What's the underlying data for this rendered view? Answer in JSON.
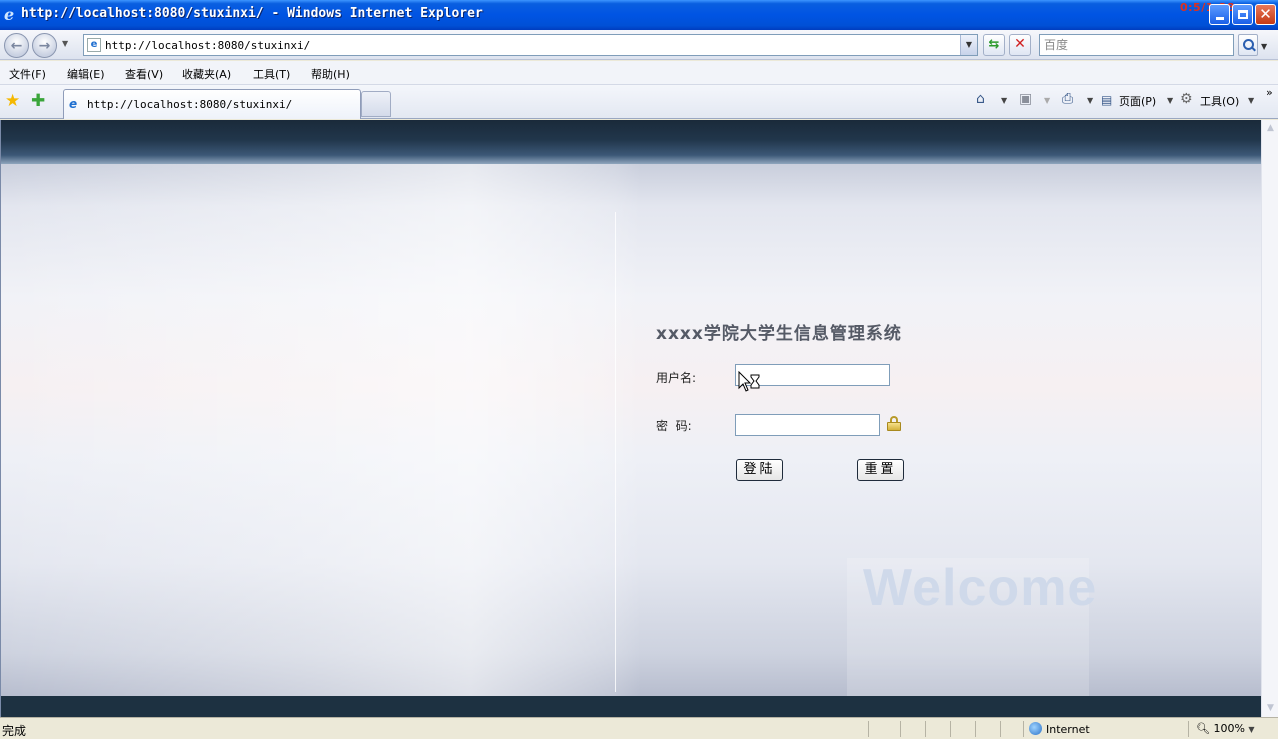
{
  "window": {
    "title": "http://localhost:8080/stuxinxi/ - Windows Internet Explorer",
    "overlay_text": "0:5/1:38"
  },
  "nav": {
    "address": "http://localhost:8080/stuxinxi/",
    "search_placeholder": "百度"
  },
  "menu": {
    "items": [
      "文件(F)",
      "编辑(E)",
      "查看(V)",
      "收藏夹(A)",
      "工具(T)",
      "帮助(H)"
    ]
  },
  "tabs": {
    "active_label": "http://localhost:8080/stuxinxi/"
  },
  "command_bar": {
    "page_label": "页面(P)",
    "tools_label": "工具(O)"
  },
  "page": {
    "system_title": "xxxx学院大学生信息管理系统",
    "username_label": "用户名:",
    "password_label": "密  码:",
    "login_button": "登陆",
    "reset_button": "重置",
    "welcome_text": "Welcome"
  },
  "status": {
    "text": "完成",
    "zone": "Internet",
    "zoom": "100%"
  },
  "colors": {
    "titlebar": "#0054e3",
    "banner_dark": "#1d3141"
  }
}
